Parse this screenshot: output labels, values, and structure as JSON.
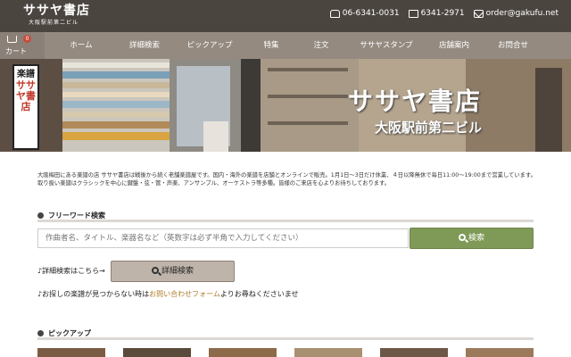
{
  "header": {
    "logo_main": "ササヤ書店",
    "logo_sub": "大阪駅前第二ビル",
    "phone": "06-6341-0031",
    "fax": "6341-2971",
    "email": "order@gakufu.net"
  },
  "nav": {
    "cart_label": "カート",
    "cart_count": "0",
    "items": [
      "ホーム",
      "詳細検索",
      "ピックアップ",
      "特集",
      "注文",
      "ササヤスタンプ",
      "店舗案内",
      "お問合せ"
    ]
  },
  "hero": {
    "title": "ササヤ書店",
    "subtitle": "大阪駅前第二ビル",
    "sign_top": "楽譜",
    "sign_name": "ササヤ書店"
  },
  "intro": "大阪梅田にある楽譜の店 ササヤ書店は戦後から続く老舗楽譜屋です。国内・海外の楽譜を店舗とオンラインで販売。1月1日～3日だけ休業、４日以降無休で毎日11:00～19:00まで営業しています。取り扱い楽譜はクラシックを中心に鍵盤・弦・管・声楽、アンサンブル、オーケストラ等多種。皆様のご来店を心よりお待ちしております。",
  "search": {
    "section_title": "フリーワード検索",
    "placeholder": "作曲者名、タイトル、楽器名など（英数字は必ず半角で入力してください）",
    "button_label": "検索",
    "detail_label": "♪詳細検索はこちら→",
    "detail_button": "詳細検索",
    "notfound_prefix": "♪お探しの楽譜が見つからない時は",
    "notfound_link": "お問い合わせフォーム",
    "notfound_suffix": "よりお尋ねくださいませ"
  },
  "pickup": {
    "section_title": "ピックアップ"
  },
  "colors": {
    "topbar": "#4b4540",
    "navbar": "#948a80",
    "search_button": "#7f9a56",
    "detail_button": "#bfb4aa",
    "link": "#b07d2a"
  }
}
